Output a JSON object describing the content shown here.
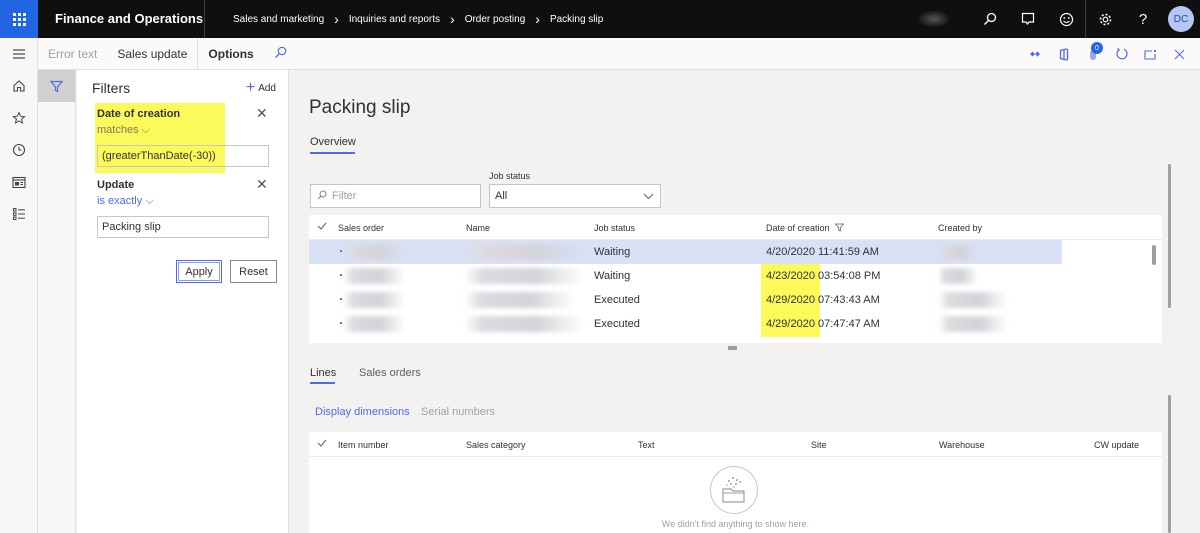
{
  "topbar": {
    "app_title": "Finance and Operations",
    "breadcrumb": [
      "Sales and marketing",
      "Inquiries and reports",
      "Order posting",
      "Packing slip"
    ],
    "icons": [
      "search-icon",
      "chat-icon",
      "smiley-icon",
      "gear-icon",
      "help-icon"
    ],
    "avatar_initials": "DC"
  },
  "leftnav": {
    "items": [
      "hamburger-icon",
      "home-icon",
      "star-icon",
      "clock-icon",
      "workspace-icon",
      "list-icon"
    ]
  },
  "actionpane": {
    "buttons": [
      "Error text",
      "Sales update",
      "Options"
    ],
    "right_icons": [
      "connect-icon",
      "office-icon",
      "attachment-icon",
      "refresh-icon",
      "popout-icon",
      "close-icon"
    ],
    "attachment_count": "0"
  },
  "filterpane": {
    "title": "Filters",
    "add_label": "Add",
    "filters": [
      {
        "field": "Date of creation",
        "operator": "matches",
        "value": "(greaterThanDate(-30))"
      },
      {
        "field": "Update",
        "operator": "is exactly",
        "value": "Packing slip"
      }
    ],
    "apply_label": "Apply",
    "reset_label": "Reset"
  },
  "main": {
    "title": "Packing slip",
    "overview_tab": "Overview",
    "filter_placeholder": "Filter",
    "job_status_label": "Job status",
    "job_status_value": "All",
    "grid": {
      "columns": [
        "Sales order",
        "Name",
        "Job status",
        "Date of creation",
        "Created by"
      ],
      "rows": [
        {
          "job_status": "Waiting",
          "date": "4/20/2020",
          "time": "11:41:59 AM",
          "selected": true
        },
        {
          "job_status": "Waiting",
          "date": "4/23/2020",
          "time": "03:54:08 PM",
          "selected": false
        },
        {
          "job_status": "Executed",
          "date": "4/29/2020",
          "time": "07:43:43 AM",
          "selected": false
        },
        {
          "job_status": "Executed",
          "date": "4/29/2020",
          "time": "07:47:47 AM",
          "selected": false
        }
      ]
    },
    "lower_tabs": [
      "Lines",
      "Sales orders"
    ],
    "lines_actions": [
      "Display dimensions",
      "Serial numbers"
    ],
    "lines_grid": {
      "columns": [
        "Item number",
        "Sales category",
        "Text",
        "Site",
        "Warehouse",
        "CW update"
      ],
      "empty_message": "We didn't find anything to show here."
    }
  },
  "colors": {
    "accent": "#4f6bed",
    "topbar": "#0f0f0f",
    "waffle": "#2266e3",
    "highlight": "#fbfa5a",
    "selected_row": "#d9e1f7"
  }
}
